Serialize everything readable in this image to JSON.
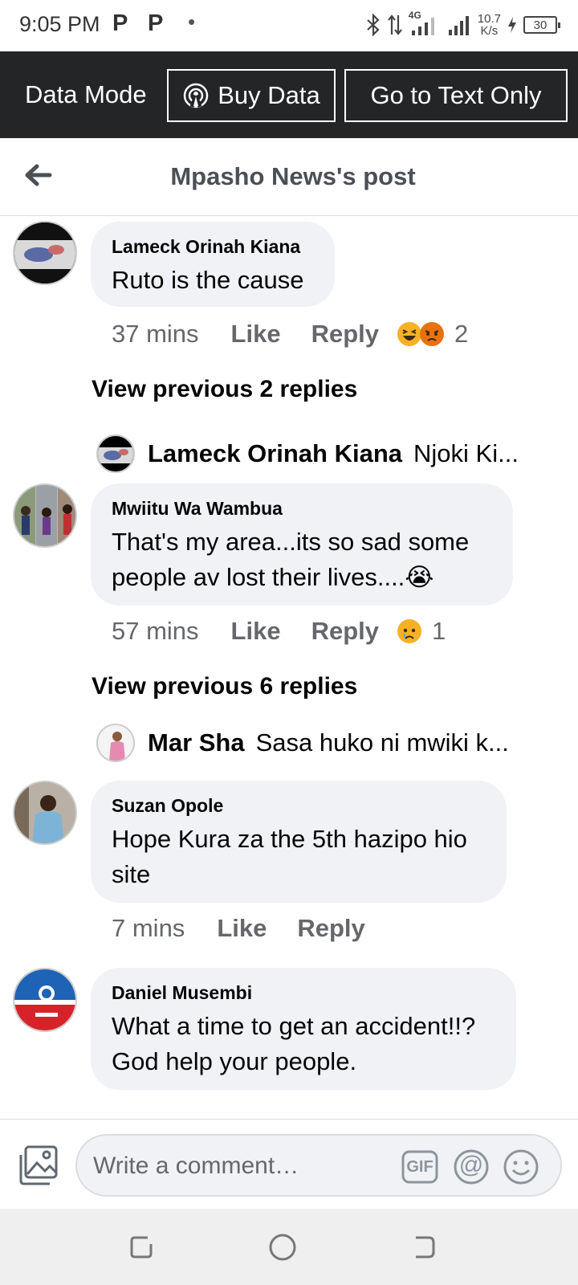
{
  "status_bar": {
    "time": "9:05 PM",
    "notif_icons": [
      "P",
      "P"
    ],
    "network": "4G",
    "speed_value": "10.7",
    "speed_unit": "K/s",
    "battery": "30"
  },
  "data_mode_bar": {
    "label": "Data Mode",
    "buy_data": "Buy Data",
    "text_only": "Go to Text Only"
  },
  "header": {
    "title": "Mpasho News's post"
  },
  "comments": [
    {
      "name": "Lameck Orinah Kiana",
      "text": "Ruto is the cause",
      "time": "37 mins",
      "like": "Like",
      "reply": "Reply",
      "reactions": [
        "haha-icon",
        "angry-icon"
      ],
      "reaction_count": "2"
    },
    {
      "name": "Mwiitu Wa Wambua",
      "text": "That's my area...its so sad some people av lost their lives....😭",
      "time": "57 mins",
      "like": "Like",
      "reply": "Reply",
      "reactions": [
        "sad-icon"
      ],
      "reaction_count": "1"
    },
    {
      "name": "Suzan Opole",
      "text": "Hope Kura za the 5th hazipo hio site",
      "time": "7 mins",
      "like": "Like",
      "reply": "Reply"
    },
    {
      "name": "Daniel Musembi",
      "text": "What a time to get an accident!!? God help your people."
    }
  ],
  "replies": [
    {
      "view_previous": "View previous 2 replies",
      "name": "Lameck Orinah Kiana",
      "text": "Njoki Ki..."
    },
    {
      "view_previous": "View previous 6 replies",
      "name": "Mar Sha",
      "text": "Sasa huko ni mwiki k..."
    }
  ],
  "composer": {
    "placeholder": "Write a comment…",
    "gif_label": "GIF",
    "at_label": "@"
  },
  "colors": {
    "bar_dark": "#242526",
    "bubble": "#f0f2f5",
    "meta_text": "#65676b"
  }
}
